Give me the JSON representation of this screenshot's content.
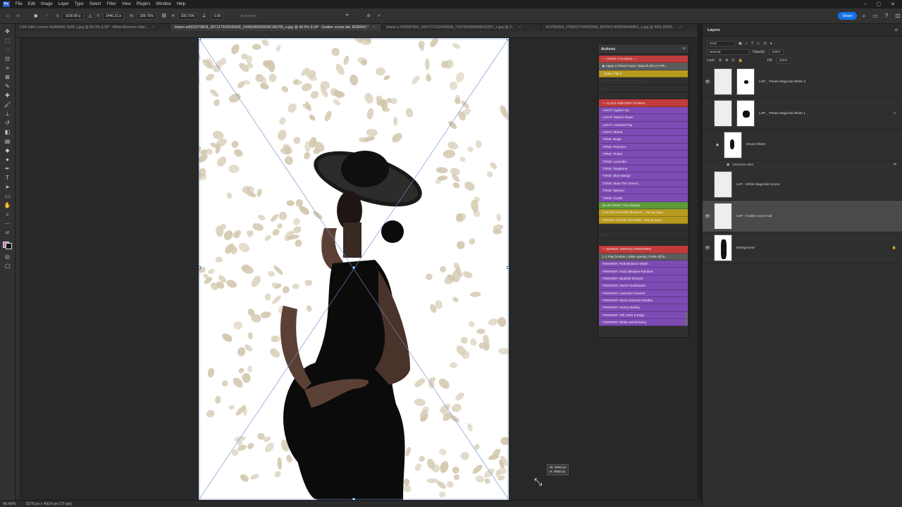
{
  "app": {
    "logo": "Ps",
    "menu": [
      "File",
      "Edit",
      "Image",
      "Layer",
      "Type",
      "Select",
      "Filter",
      "View",
      "Plugins",
      "Window",
      "Help"
    ],
    "window_controls": [
      "–",
      "▢",
      "✕"
    ]
  },
  "options_bar": {
    "x_label": "X:",
    "x_value": "1630.80 p",
    "y_label": "Y:",
    "y_value": "2446.21 p",
    "w_label": "W:",
    "w_value": "339.75%",
    "h_label": "H:",
    "h_value": "339.75%",
    "angle_value": "0.00",
    "interpolation": "Automatic",
    "share_label": "Share"
  },
  "tabs": [
    {
      "label": "LSP-Little Lemon-SHARING SIZE-1.jpg @ 83.2% (LSP - White Blossom Side...",
      "active": false
    },
    {
      "label": "tinann a4333373818_397127343035659_14340282656596196709_n.jpg @ 40.5% (LSP - Golden scene tall, RGB/8#) *",
      "active": true
    },
    {
      "label": "tinann a 433387464_1461771231426608_7197534366688162357_n.jpg @ 2...",
      "active": false
    },
    {
      "label": "423766364_2782511794552560_8625537459030604853_n.jpg @ 50% (RGB...",
      "active": false
    }
  ],
  "status_bar": {
    "zoom": "40.48%",
    "doc_size": "3276 px x 4914 px (72 ppi)"
  },
  "size_tooltip": {
    "w": "W: 3262 px",
    "h": "H: 4892 px"
  },
  "actions_panel": {
    "title": "Actions",
    "items": [
      {
        "label": "--- APPLY A FLORAL ---",
        "color": "#c23b3b"
      },
      {
        "label": "▶ Apply A Floral Frame / Branch (PLAY FIR...",
        "color": "#5c5c5c"
      },
      {
        "label": "- Extra: Flip It",
        "color": "#b79a1e"
      },
      {
        "label": "- - - - - - - - - - - - - - - - - - - -",
        "color": "gap"
      },
      {
        "label": "- - -",
        "color": "gap"
      },
      {
        "label": "",
        "color": "gap"
      },
      {
        "label": "--- CLICK AND EDIT FLORAL",
        "color": "#c23b3b"
      },
      {
        "label": "LIGHT: Lighten Up",
        "color": "#7e4bb5"
      },
      {
        "label": "LIGHT: Darken Down",
        "color": "#7e4bb5"
      },
      {
        "label": "LIGHT: Contrast Pop",
        "color": "#7e4bb5"
      },
      {
        "label": "LIGHT: Muted",
        "color": "#7e4bb5"
      },
      {
        "label": "TONE: Beige",
        "color": "#7e4bb5"
      },
      {
        "label": "TONE: Peachier",
        "color": "#7e4bb5"
      },
      {
        "label": "TONE: Pinker",
        "color": "#7e4bb5"
      },
      {
        "label": "TONE: Lavender",
        "color": "#7e4bb5"
      },
      {
        "label": "TONE: Tangerine",
        "color": "#7e4bb5"
      },
      {
        "label": "TONE: Blue Mango",
        "color": "#7e4bb5"
      },
      {
        "label": "TONE: Mute The Greens",
        "color": "#7e4bb5"
      },
      {
        "label": "TONE: Warmer",
        "color": "#7e4bb5"
      },
      {
        "label": "TONE: Cooler",
        "color": "#7e4bb5"
      },
      {
        "label": "BLUR PAINT: You Choose",
        "color": "#5c9a3a"
      },
      {
        "label": "COLOR CHANGE MANUAL - Set up layer",
        "color": "#b79a1e"
      },
      {
        "label": "PASTAL COLOR CHANGE - Set up layer",
        "color": "#b79a1e"
      },
      {
        "label": "",
        "color": "gap"
      },
      {
        "label": "- - -",
        "color": "gap"
      },
      {
        "label": "",
        "color": "gap"
      },
      {
        "label": "--- BONUS: GENTLE FINISHERS",
        "color": "#c23b3b"
      },
      {
        "label": "[ ! ] Play finisher | Slide opacity | Paint off fa...",
        "color": "#5c5c5c"
      },
      {
        "label": "FINISHER: Pink Blossom Wash",
        "color": "#7e4bb5"
      },
      {
        "label": "FINISHER: Hazy Meadow Rainbow",
        "color": "#7e4bb5"
      },
      {
        "label": "FINISHER: Bluebell Dreams",
        "color": "#7e4bb5"
      },
      {
        "label": "FINISHER: Sweet Sunflowers",
        "color": "#7e4bb5"
      },
      {
        "label": "FINISHER: Lavender Dreams",
        "color": "#7e4bb5"
      },
      {
        "label": "FINISHER: Warm Summer Medley",
        "color": "#7e4bb5"
      },
      {
        "label": "FINISHER: Sunny Medley",
        "color": "#7e4bb5"
      },
      {
        "label": "FINISHER: Tall, Dark & Edgy",
        "color": "#7e4bb5"
      },
      {
        "label": "FINISHER: White and Dreamy",
        "color": "#7e4bb5"
      }
    ]
  },
  "layers_panel": {
    "title": "Layers",
    "search_placeholder": "Kind",
    "blend_mode": "Normal",
    "opacity_label": "Opacity:",
    "opacity_value": "100%",
    "lock_label": "Lock:",
    "fill_label": "Fill:",
    "fill_value": "100%",
    "layers": [
      {
        "name": "LSP _ Petals Magnolia White 2",
        "visible": true,
        "has_mask": true,
        "selected": false
      },
      {
        "name": "LSP _ Petals Magnolia White 1",
        "visible": false,
        "has_mask": true,
        "selected": false
      },
      {
        "name": "Smart Filters",
        "visible": false,
        "has_mask": false,
        "selected": false,
        "sub": true
      },
      {
        "name": "LSP - White Magnolia Scene",
        "visible": false,
        "has_mask": false,
        "selected": false
      },
      {
        "name": "LSP - Golden scene tall",
        "visible": true,
        "has_mask": false,
        "selected": true
      },
      {
        "name": "Background",
        "visible": true,
        "has_mask": false,
        "selected": false,
        "italic": true,
        "locked": true
      }
    ],
    "gaussian_blur_label": "Gaussian Blur"
  }
}
